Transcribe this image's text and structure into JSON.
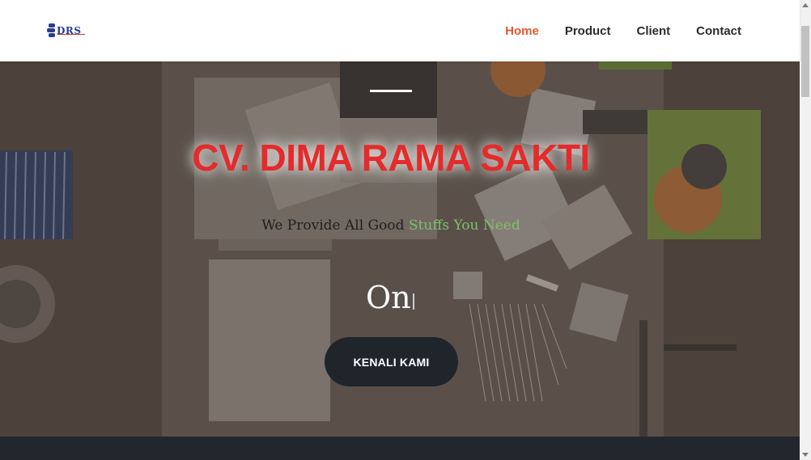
{
  "brand": {
    "logo_text": "DRS",
    "colors": {
      "text": "#2a3f8f",
      "accent": "#c23a3a"
    }
  },
  "nav": {
    "items": [
      {
        "label": "Home",
        "active": true
      },
      {
        "label": "Product",
        "active": false
      },
      {
        "label": "Client",
        "active": false
      },
      {
        "label": "Contact",
        "active": false
      }
    ],
    "active_color": "#e8572f"
  },
  "hero": {
    "title": "CV. DIMA RAMA SAKTI",
    "tagline_plain": "We Provide All Good ",
    "tagline_accent": "Stuffs You Need",
    "typed_text": "On",
    "button_label": "KENALI KAMI",
    "colors": {
      "title": "#e42b2b",
      "accent": "#7fbf6a",
      "button": "#20252b"
    }
  }
}
